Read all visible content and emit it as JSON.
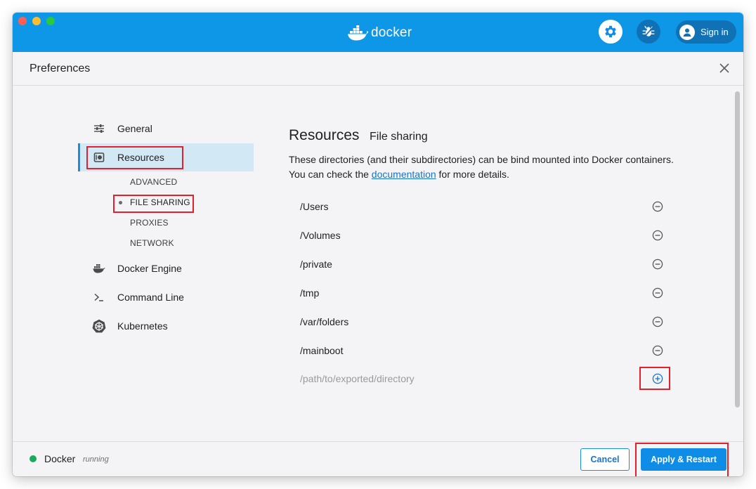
{
  "app": {
    "logo_text": "docker",
    "signin_label": "Sign in"
  },
  "header": {
    "title": "Preferences"
  },
  "sidebar": {
    "items": [
      {
        "label": "General",
        "icon": "sliders-icon"
      },
      {
        "label": "Resources",
        "icon": "resources-icon",
        "active": true
      },
      {
        "label": "Docker Engine",
        "icon": "whale-icon"
      },
      {
        "label": "Command Line",
        "icon": "terminal-icon"
      },
      {
        "label": "Kubernetes",
        "icon": "helm-wheel-icon"
      }
    ],
    "subitems": [
      {
        "label": "ADVANCED"
      },
      {
        "label": "FILE SHARING",
        "active": true
      },
      {
        "label": "PROXIES"
      },
      {
        "label": "NETWORK"
      }
    ]
  },
  "panel": {
    "title": "Resources",
    "subtitle": "File sharing",
    "desc_before": "These directories (and their subdirectories) can be bind mounted into Docker containers. You can check the ",
    "desc_link": "documentation",
    "desc_after": " for more details.",
    "directories": [
      "/Users",
      "/Volumes",
      "/private",
      "/tmp",
      "/var/folders",
      "/mainboot"
    ],
    "add_placeholder": "/path/to/exported/directory"
  },
  "footer": {
    "status_name": "Docker",
    "status_state": "running",
    "cancel_label": "Cancel",
    "apply_label": "Apply & Restart"
  },
  "colors": {
    "titlebar": "#0e97e6",
    "accent": "#0e8ce6",
    "status_running": "#1aaa5c",
    "highlight_box": "#e3202b",
    "active_nav_bg": "#d3e8f5"
  }
}
